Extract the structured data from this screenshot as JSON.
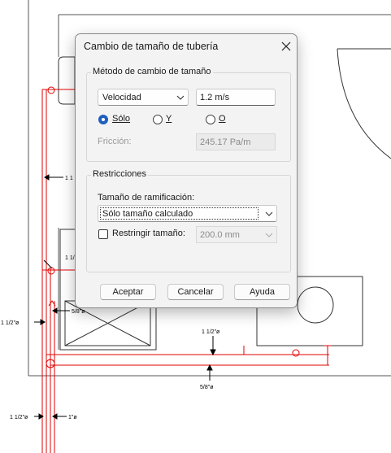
{
  "cad": {
    "labels": [
      "1 1/2\"ø",
      "1 1/2\"ø",
      "5/8\"ø",
      "1 1/2\"ø",
      "5/8\"ø",
      "1 1/2\"ø",
      "1\"ø",
      "1 1",
      "1 1/"
    ]
  },
  "dialog": {
    "title": "Cambio de tamaño de tubería",
    "close_icon": "close-icon",
    "method": {
      "legend": "Método de cambio de tamaño",
      "type_value": "Velocidad",
      "value_input": "1.2 m/s",
      "radio_only": "Sólo",
      "radio_and": "Y",
      "radio_or": "O",
      "selected_radio": "Sólo",
      "friction_label": "Fricción:",
      "friction_value": "245.17 Pa/m"
    },
    "restrictions": {
      "legend": "Restricciones",
      "branch_label": "Tamaño de ramificación:",
      "branch_value": "Sólo tamaño calculado",
      "restrict_label": "Restringir tamaño:",
      "restrict_checked": false,
      "restrict_value": "200.0 mm"
    },
    "buttons": {
      "ok": "Aceptar",
      "cancel": "Cancelar",
      "help": "Ayuda"
    }
  },
  "colors": {
    "accent": "#1f5fbf",
    "pipe": "#e00000"
  }
}
